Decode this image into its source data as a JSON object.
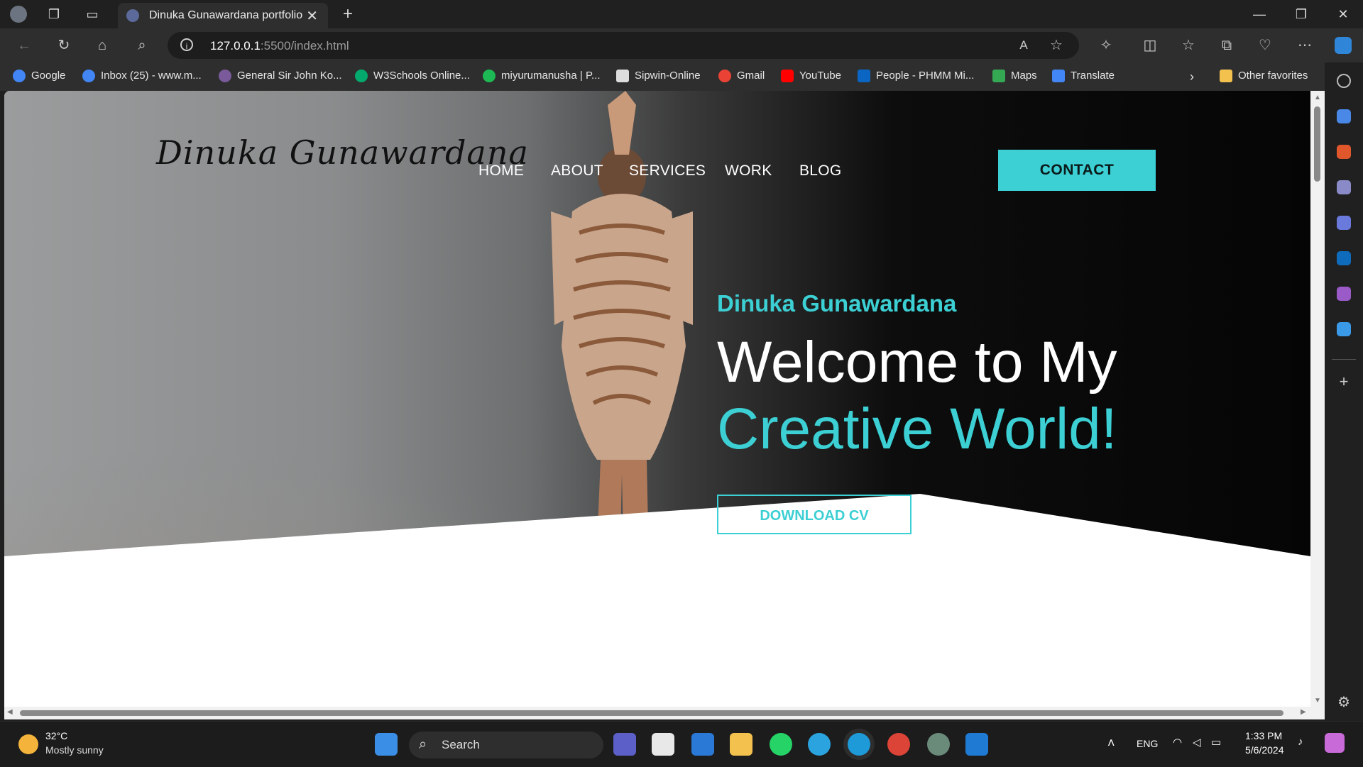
{
  "browser": {
    "tab_title": "Dinuka Gunawardana portfolio",
    "url_host": "127.0.0.1",
    "url_path": ":5500/index.html",
    "bookmarks": [
      "Google",
      "Inbox (25) - www.m...",
      "General Sir John Ko...",
      "W3Schools Online...",
      "miyurumanusha | P...",
      "Sipwin-Online",
      "Gmail",
      "YouTube",
      "People - PHMM Mi...",
      "Maps",
      "Translate"
    ],
    "other_favorites": "Other favorites"
  },
  "site": {
    "logo": "Dinuka Gunawardana",
    "nav": [
      "HOME",
      "ABOUT",
      "SERVICES",
      "WORK",
      "BLOG"
    ],
    "contact": "CONTACT",
    "hero_name": "Dinuka Gunawardana",
    "hero_line1": "Welcome to My",
    "hero_line2": "Creative World!",
    "cv_button": "DOWNLOAD CV",
    "colors": {
      "accent": "#3ccfd3"
    }
  },
  "taskbar": {
    "weather_temp": "32°C",
    "weather_desc": "Mostly sunny",
    "search": "Search",
    "lang": "ENG",
    "time": "1:33 PM",
    "date": "5/6/2024"
  }
}
